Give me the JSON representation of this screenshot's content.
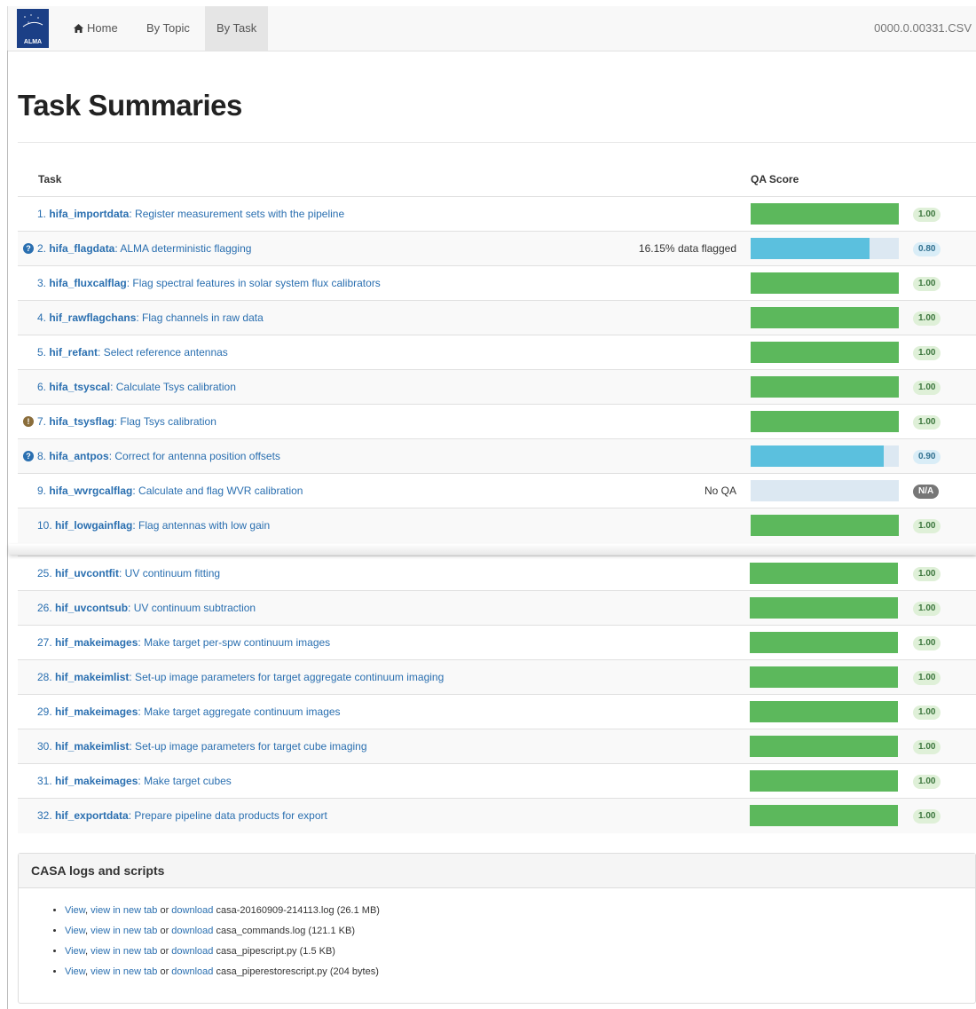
{
  "navbar": {
    "logo_text": "ALMA",
    "home": "Home",
    "by_topic": "By Topic",
    "by_task": "By Task",
    "csv": "0000.0.00331.CSV"
  },
  "page_title": "Task Summaries",
  "table": {
    "col_task": "Task",
    "col_qa": "QA Score",
    "rows": [
      {
        "num": "1.",
        "task": "hifa_importdata",
        "desc": ": Register measurement sets with the pipeline",
        "score": 1.0,
        "badge": "1.00",
        "status": "good",
        "note": "",
        "icon": ""
      },
      {
        "num": "2.",
        "task": "hifa_flagdata",
        "desc": ": ALMA deterministic flagging",
        "score": 0.8,
        "badge": "0.80",
        "status": "info",
        "note": "16.15% data flagged",
        "icon": "info"
      },
      {
        "num": "3.",
        "task": "hifa_fluxcalflag",
        "desc": ": Flag spectral features in solar system flux calibrators",
        "score": 1.0,
        "badge": "1.00",
        "status": "good",
        "note": "",
        "icon": ""
      },
      {
        "num": "4.",
        "task": "hif_rawflagchans",
        "desc": ": Flag channels in raw data",
        "score": 1.0,
        "badge": "1.00",
        "status": "good",
        "note": "",
        "icon": ""
      },
      {
        "num": "5.",
        "task": "hif_refant",
        "desc": ": Select reference antennas",
        "score": 1.0,
        "badge": "1.00",
        "status": "good",
        "note": "",
        "icon": ""
      },
      {
        "num": "6.",
        "task": "hifa_tsyscal",
        "desc": ": Calculate Tsys calibration",
        "score": 1.0,
        "badge": "1.00",
        "status": "good",
        "note": "",
        "icon": ""
      },
      {
        "num": "7.",
        "task": "hifa_tsysflag",
        "desc": ": Flag Tsys calibration",
        "score": 1.0,
        "badge": "1.00",
        "status": "good",
        "note": "",
        "icon": "warn"
      },
      {
        "num": "8.",
        "task": "hifa_antpos",
        "desc": ": Correct for antenna position offsets",
        "score": 0.9,
        "badge": "0.90",
        "status": "info",
        "note": "",
        "icon": "info"
      },
      {
        "num": "9.",
        "task": "hifa_wvrgcalflag",
        "desc": ": Calculate and flag WVR calibration",
        "score": 0,
        "badge": "N/A",
        "status": "na",
        "note": "No QA",
        "icon": ""
      },
      {
        "num": "10.",
        "task": "hif_lowgainflag",
        "desc": ": Flag antennas with low gain",
        "score": 1.0,
        "badge": "1.00",
        "status": "good",
        "note": "",
        "icon": ""
      },
      {
        "num": "25.",
        "task": "hif_uvcontfit",
        "desc": ": UV continuum fitting",
        "score": 1.0,
        "badge": "1.00",
        "status": "good",
        "note": "",
        "icon": ""
      },
      {
        "num": "26.",
        "task": "hif_uvcontsub",
        "desc": ": UV continuum subtraction",
        "score": 1.0,
        "badge": "1.00",
        "status": "good",
        "note": "",
        "icon": ""
      },
      {
        "num": "27.",
        "task": "hif_makeimages",
        "desc": ": Make target per-spw continuum images",
        "score": 1.0,
        "badge": "1.00",
        "status": "good",
        "note": "",
        "icon": ""
      },
      {
        "num": "28.",
        "task": "hif_makeimlist",
        "desc": ": Set-up image parameters for target aggregate continuum imaging",
        "score": 1.0,
        "badge": "1.00",
        "status": "good",
        "note": "",
        "icon": ""
      },
      {
        "num": "29.",
        "task": "hif_makeimages",
        "desc": ": Make target aggregate continuum images",
        "score": 1.0,
        "badge": "1.00",
        "status": "good",
        "note": "",
        "icon": ""
      },
      {
        "num": "30.",
        "task": "hif_makeimlist",
        "desc": ": Set-up image parameters for target cube imaging",
        "score": 1.0,
        "badge": "1.00",
        "status": "good",
        "note": "",
        "icon": ""
      },
      {
        "num": "31.",
        "task": "hif_makeimages",
        "desc": ": Make target cubes",
        "score": 1.0,
        "badge": "1.00",
        "status": "good",
        "note": "",
        "icon": ""
      },
      {
        "num": "32.",
        "task": "hif_exportdata",
        "desc": ": Prepare pipeline data products for export",
        "score": 1.0,
        "badge": "1.00",
        "status": "good",
        "note": "",
        "icon": ""
      }
    ]
  },
  "colors": {
    "good_bar": "#5cb85c",
    "info_bar": "#5bc0de",
    "good_badge_bg": "#dff0d8",
    "good_badge_fg": "#3c763d",
    "info_badge_bg": "#d9edf7",
    "info_badge_fg": "#31708f",
    "na_badge_bg": "#777777",
    "na_badge_fg": "#ffffff"
  },
  "casa": {
    "heading": "CASA logs and scripts",
    "link_view": "View",
    "link_new_tab": "view in new tab",
    "link_or": "or",
    "link_download": "download",
    "files": [
      {
        "name": "casa-20160909-214113.log",
        "size": "(26.1 MB)"
      },
      {
        "name": "casa_commands.log",
        "size": "(121.1 KB)"
      },
      {
        "name": "casa_pipescript.py",
        "size": "(1.5 KB)"
      },
      {
        "name": "casa_piperestorescript.py",
        "size": "(204 bytes)"
      }
    ]
  }
}
